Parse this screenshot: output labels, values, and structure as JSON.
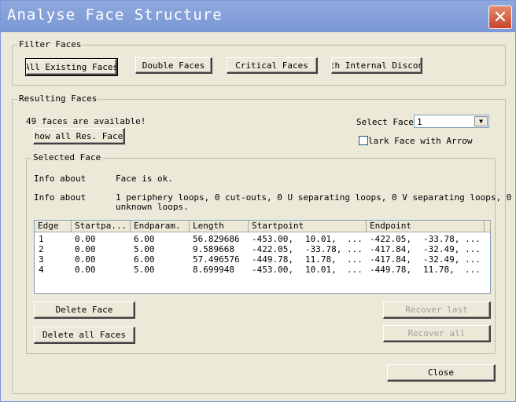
{
  "window": {
    "title": "Analyse Face Structure",
    "close_label": "✕"
  },
  "filter": {
    "label": "Filter Faces",
    "all_existing": "All Existing Faces",
    "double": "Double Faces",
    "critical": "Critical Faces",
    "internal": "th Internal Discon"
  },
  "results": {
    "label": "Resulting Faces",
    "count_text": "49 faces are available!",
    "show_all": "Show all Res. Faces",
    "select_face_label": "Select Face",
    "select_face_value": "1",
    "mark_face_label": "lark Face with Arrow"
  },
  "selected": {
    "label": "Selected Face",
    "info1_label": "Info about",
    "info1_value": "Face is ok.",
    "info2_label": "Info about",
    "info2_value_line1": "1 periphery loops, 0 cut-outs, 0 U separating loops, 0 V separating loops, 0",
    "info2_value_line2": "unknown loops.",
    "columns": [
      "Edge",
      "Startpa...",
      "Endparam.",
      "Length",
      "Startpoint",
      "Endpoint"
    ],
    "rows": [
      [
        "1",
        "0.00",
        "6.00",
        "56.829686",
        "-453.00,",
        "10.01,",
        "...",
        "-422.05,",
        "-33.78,",
        "..."
      ],
      [
        "2",
        "0.00",
        "5.00",
        "9.589668",
        "-422.05,",
        "-33.78,",
        "...",
        "-417.84,",
        "-32.49,",
        "..."
      ],
      [
        "3",
        "0.00",
        "6.00",
        "57.496576",
        "-449.78,",
        "11.78,",
        "...",
        "-417.84,",
        "-32.49,",
        "..."
      ],
      [
        "4",
        "0.00",
        "5.00",
        "8.699948",
        "-453.00,",
        "10.01,",
        "...",
        "-449.78,",
        "11.78,",
        "..."
      ]
    ],
    "delete_face": "Delete Face",
    "delete_all": "Delete all Faces",
    "recover_last": "Recover last",
    "recover_all": "Recover all"
  },
  "footer": {
    "close": "Close"
  }
}
